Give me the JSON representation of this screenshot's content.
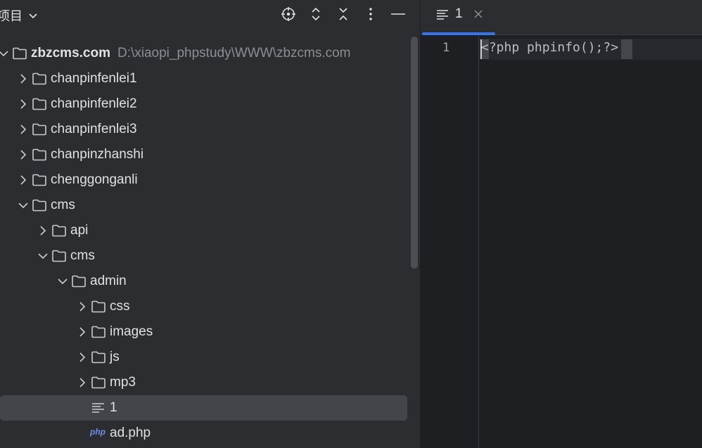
{
  "project_panel": {
    "title": "项目",
    "header_icons": [
      "locate-icon",
      "expand-collapse-icon",
      "collapse-all-icon",
      "more-options-icon",
      "minimize-icon"
    ],
    "root": {
      "label": "zbzcms.com",
      "path": "D:\\xiaopi_phpstudy\\WWW\\zbzcms.com"
    },
    "tree": [
      {
        "label": "chanpinfenlei1",
        "kind": "folder",
        "expanded": false
      },
      {
        "label": "chanpinfenlei2",
        "kind": "folder",
        "expanded": false
      },
      {
        "label": "chanpinfenlei3",
        "kind": "folder",
        "expanded": false
      },
      {
        "label": "chanpinzhanshi",
        "kind": "folder",
        "expanded": false
      },
      {
        "label": "chenggonganli",
        "kind": "folder",
        "expanded": false
      },
      {
        "label": "cms",
        "kind": "folder",
        "expanded": true
      },
      {
        "label": "api",
        "kind": "folder",
        "expanded": false
      },
      {
        "label": "cms",
        "kind": "folder",
        "expanded": true
      },
      {
        "label": "admin",
        "kind": "folder",
        "expanded": true
      },
      {
        "label": "css",
        "kind": "folder",
        "expanded": false
      },
      {
        "label": "images",
        "kind": "folder",
        "expanded": false
      },
      {
        "label": "js",
        "kind": "folder",
        "expanded": false
      },
      {
        "label": "mp3",
        "kind": "folder",
        "expanded": false
      },
      {
        "label": "1",
        "kind": "text-file",
        "selected": true
      },
      {
        "label": "ad.php",
        "kind": "php-file",
        "badge": "php"
      }
    ]
  },
  "editor": {
    "tab": {
      "label": "1",
      "icon": "text-file-icon"
    },
    "lines": [
      {
        "number": "1",
        "code": "<?php phpinfo();?>"
      }
    ]
  },
  "colors": {
    "panel_bg": "#2b2d30",
    "editor_bg": "#1e1f22",
    "accent": "#3574f0",
    "selection": "#43454a",
    "muted_text": "#8b8e94"
  }
}
